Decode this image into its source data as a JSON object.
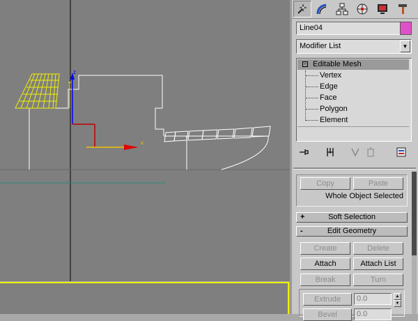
{
  "viewport": {
    "axis_labels": {
      "z": "z",
      "x": "x"
    }
  },
  "panel": {
    "tabs": [
      {
        "name": "create-tab",
        "icon": "create-icon",
        "active": true
      },
      {
        "name": "modify-tab",
        "icon": "modify-icon",
        "active": false
      },
      {
        "name": "hierarchy-tab",
        "icon": "hierarchy-icon",
        "active": false
      },
      {
        "name": "motion-tab",
        "icon": "motion-icon",
        "active": false
      },
      {
        "name": "display-tab",
        "icon": "display-icon",
        "active": false
      },
      {
        "name": "utilities-tab",
        "icon": "utilities-icon",
        "active": false
      }
    ],
    "object_name": "Line04",
    "object_color": "#e050c8",
    "modifier_list": "Modifier List",
    "stack": {
      "root": "Editable Mesh",
      "root_toggle": "⊟",
      "subobjects": [
        "Vertex",
        "Edge",
        "Face",
        "Polygon",
        "Element"
      ]
    },
    "selection": {
      "copy": "Copy",
      "paste": "Paste",
      "status": "Whole Object Selected"
    },
    "soft_selection": {
      "toggle": "+",
      "label": "Soft Selection"
    },
    "edit_geometry": {
      "toggle": "-",
      "label": "Edit Geometry",
      "create": "Create",
      "delete": "Delete",
      "attach": "Attach",
      "attach_list": "Attach List",
      "break": "Break",
      "turn": "Turn",
      "extrude": "Extrude",
      "extrude_value": "0.0",
      "bevel": "Bevel",
      "bevel_value": "0.0"
    }
  }
}
